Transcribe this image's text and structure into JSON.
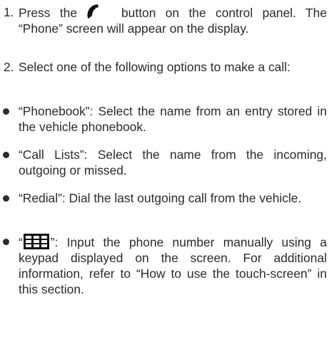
{
  "steps": [
    {
      "number": "1.",
      "before_icon": "Press the",
      "icon": "phone-handset-icon",
      "after_icon": "button on the control panel. The “Phone” screen will appear on the display."
    },
    {
      "number": "2.",
      "text": "Select one of the following options to make a call:"
    }
  ],
  "options": [
    {
      "text": "“Phonebook”: Select the name from an entry stored in the vehicle phonebook."
    },
    {
      "text": "“Call Lists”: Select the name from the incoming, outgoing or missed."
    },
    {
      "text": "“Redial”: Dial the last outgoing call from the vehicle."
    },
    {
      "before_icon": "“",
      "icon": "keypad-icon",
      "after_icon": "”: Input the phone number manually using a keypad displayed on the screen. For additional information, refer to “How to use the touch-screen” in this section."
    }
  ]
}
